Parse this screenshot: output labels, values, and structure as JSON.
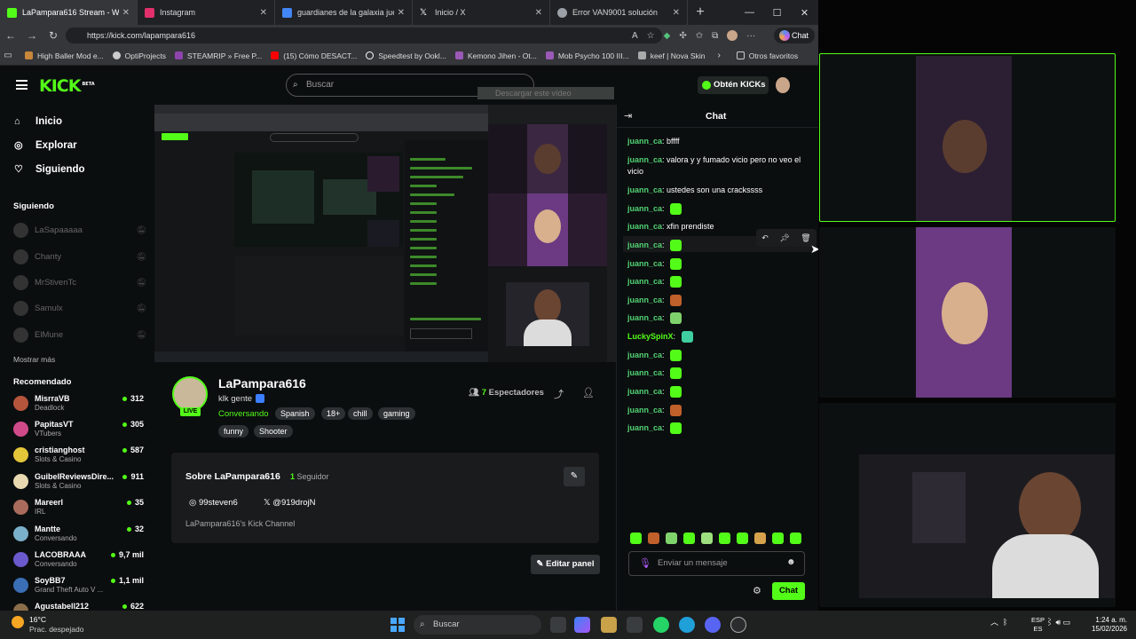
{
  "browser": {
    "tabs": [
      {
        "title": "LaPampara616 Stream - Watch",
        "color": "#53fc18"
      },
      {
        "title": "Instagram",
        "color": "#e1306c"
      },
      {
        "title": "guardianes de la galaxia juego",
        "color": "#4285f4"
      },
      {
        "title": "Inicio / X",
        "color": "#ffffff"
      },
      {
        "title": "Error VAN9001 solución",
        "color": "#9aa0a6"
      }
    ],
    "url": "https://kick.com/lapampara616",
    "chat_button": "Chat",
    "bookmarks": [
      {
        "label": "High Baller Mod e...",
        "color": "#c8873a"
      },
      {
        "label": "OptiProjects",
        "color": "#cccccc"
      },
      {
        "label": "STEAMRIP » Free P...",
        "color": "#8e44ad"
      },
      {
        "label": "(15) Cómo DESACT...",
        "color": "#ff0000"
      },
      {
        "label": "Speedtest by Ookl...",
        "color": "#ffffff"
      },
      {
        "label": "Kemono Jihen - Ot...",
        "color": "#9b59b6"
      },
      {
        "label": "Mob Psycho 100 III...",
        "color": "#9b59b6"
      },
      {
        "label": "keef | Nova Skin",
        "color": "#aaaaaa"
      }
    ],
    "other_favorites": "Otros favoritos"
  },
  "kick": {
    "search_placeholder": "Buscar",
    "download_overlay": "Descargar este vídeo",
    "obtain_kicks": "Obtén KICKs",
    "nav": [
      {
        "label": "Inicio",
        "icon": "home-icon"
      },
      {
        "label": "Explorar",
        "icon": "compass-icon"
      },
      {
        "label": "Siguiendo",
        "icon": "heart-icon"
      }
    ],
    "following_header": "Siguiendo",
    "following": [
      "LaSapaaaaa",
      "Chanty",
      "MrStivenTc",
      "Samulx",
      "ElMune"
    ],
    "show_more": "Mostrar más",
    "recommended_header": "Recomendado",
    "recommended": [
      {
        "name": "MisrraVB",
        "category": "Deadlock",
        "viewers": "312",
        "color": "#b5553c"
      },
      {
        "name": "PapitasVT",
        "category": "VTubers",
        "viewers": "305",
        "color": "#d04a8a"
      },
      {
        "name": "cristianghost",
        "category": "Slots & Casino",
        "viewers": "587",
        "color": "#e3c53a"
      },
      {
        "name": "GuibelReviewsDire...",
        "category": "Slots & Casino",
        "viewers": "911",
        "color": "#e8d9b0"
      },
      {
        "name": "Mareerl",
        "category": "IRL",
        "viewers": "35",
        "color": "#a86b5c"
      },
      {
        "name": "Mantte",
        "category": "Conversando",
        "viewers": "32",
        "color": "#7ab0c9"
      },
      {
        "name": "LACOBRAAA",
        "category": "Conversando",
        "viewers": "9,7 mil",
        "color": "#6a5acd"
      },
      {
        "name": "SoyBB7",
        "category": "Grand Theft Auto V ...",
        "viewers": "1,1 mil",
        "color": "#3a6fb5"
      },
      {
        "name": "Agustabell212",
        "category": "",
        "viewers": "622",
        "color": "#8a6d4a"
      }
    ],
    "channel": {
      "name": "LaPampara616",
      "title": "klk gente",
      "live": "LIVE",
      "category": "Conversando",
      "tags": [
        "Spanish",
        "18+",
        "chill",
        "gaming",
        "funny",
        "Shooter"
      ],
      "viewers_count": "7",
      "viewers_label": "Espectadores"
    },
    "about": {
      "title": "Sobre LaPampara616",
      "followers_count": "1",
      "followers_label": "Seguidor",
      "instagram": "99steven6",
      "x": "@919drojN",
      "description": "LaPampara616's Kick Channel"
    },
    "edit_panel": "Editar panel",
    "chat": {
      "title": "Chat",
      "messages": [
        {
          "user": "juann_ca",
          "text": "bffff",
          "emote": ""
        },
        {
          "user": "juann_ca",
          "text": "valora y y fumado vicio pero no veo el",
          "emote": ""
        },
        {
          "user": "",
          "text": "vicio",
          "emote": ""
        },
        {
          "user": "juann_ca",
          "text": "ustedes son una crackssss",
          "emote": ""
        },
        {
          "user": "juann_ca",
          "text": "",
          "emote": "#53fc18"
        },
        {
          "user": "juann_ca",
          "text": "xfin prendiste",
          "emote": ""
        },
        {
          "user": "juann_ca",
          "text": "",
          "emote": "#53fc18"
        },
        {
          "user": "juann_ca",
          "text": "",
          "emote": "#53fc18"
        },
        {
          "user": "juann_ca",
          "text": "",
          "emote": "#53fc18"
        },
        {
          "user": "juann_ca",
          "text": "",
          "emote": "#c0602a"
        },
        {
          "user": "juann_ca",
          "text": "",
          "emote": "#7fd36b"
        },
        {
          "user": "LuckySpinX",
          "text": "",
          "emote": "#3fcf9e"
        },
        {
          "user": "juann_ca",
          "text": "",
          "emote": "#53fc18"
        },
        {
          "user": "juann_ca",
          "text": "",
          "emote": "#53fc18"
        },
        {
          "user": "juann_ca",
          "text": "",
          "emote": "#53fc18"
        },
        {
          "user": "juann_ca",
          "text": "",
          "emote": "#c0602a"
        },
        {
          "user": "juann_ca",
          "text": "",
          "emote": "#53fc18"
        }
      ],
      "input_placeholder": "Enviar un mensaje",
      "send": "Chat"
    }
  },
  "taskbar": {
    "temperature": "16°C",
    "weather": "Prac. despejado",
    "search": "Buscar",
    "lang_top": "ESP",
    "lang_bottom": "ES",
    "time": "1:24 a. m.",
    "date": "15/02/2026"
  }
}
